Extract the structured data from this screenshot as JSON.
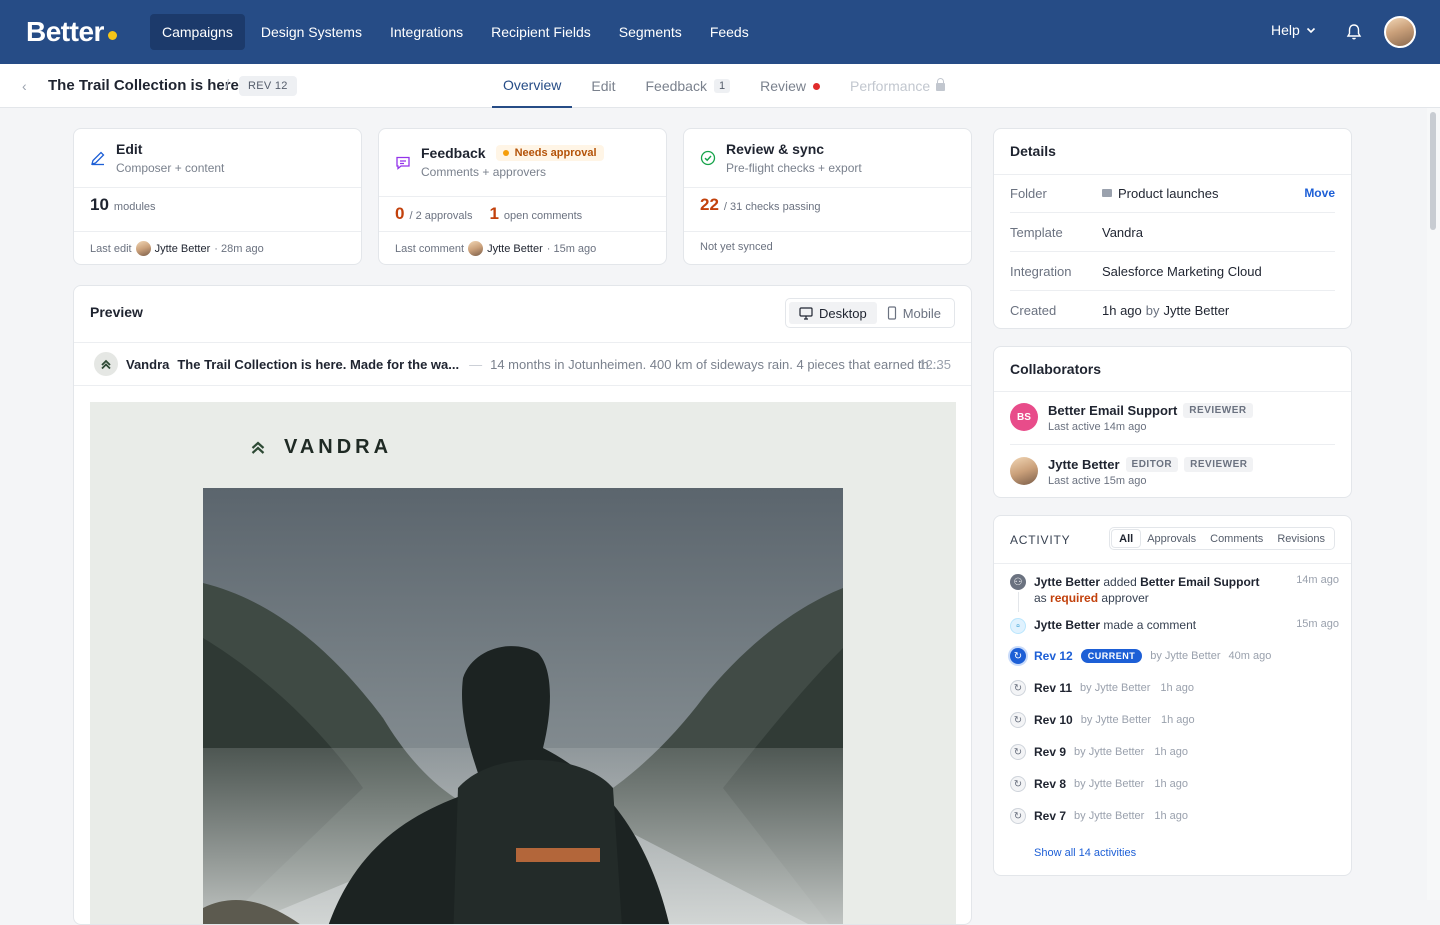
{
  "brand": {
    "name": "Better"
  },
  "nav": {
    "items": [
      "Campaigns",
      "Design Systems",
      "Integrations",
      "Recipient Fields",
      "Segments",
      "Feeds"
    ],
    "help": "Help"
  },
  "subbar": {
    "title": "The Trail Collection is here",
    "rev": "REV 12",
    "tabs": {
      "overview": "Overview",
      "edit": "Edit",
      "feedback": "Feedback",
      "feedback_count": "1",
      "review": "Review",
      "performance": "Performance"
    }
  },
  "cards": {
    "edit": {
      "title": "Edit",
      "sub": "Composer + content",
      "num": "10",
      "num_label": "modules",
      "foot_label": "Last edit",
      "foot_user": "Jytte Better",
      "foot_time": "· 28m ago"
    },
    "feedback": {
      "title": "Feedback",
      "badge": "Needs approval",
      "sub": "Comments + approvers",
      "num1": "0",
      "num1_label": "/ 2 approvals",
      "num2": "1",
      "num2_label": "open comments",
      "foot_label": "Last comment",
      "foot_user": "Jytte Better",
      "foot_time": "· 15m ago"
    },
    "review": {
      "title": "Review & sync",
      "sub": "Pre-flight checks + export",
      "num": "22",
      "num_label": "/ 31 checks passing",
      "foot": "Not yet synced"
    }
  },
  "preview": {
    "title": "Preview",
    "desktop": "Desktop",
    "mobile": "Mobile",
    "sender": "Vandra",
    "subject": "The Trail Collection is here. Made for the wa...",
    "preheader": "14 months in Jotunheimen. 400 km of sideways rain. 4 pieces that earned th...",
    "time": "12:35",
    "email_brand": "VANDRA"
  },
  "details": {
    "title": "Details",
    "folder_label": "Folder",
    "folder_value": "Product launches",
    "move": "Move",
    "template_label": "Template",
    "template_value": "Vandra",
    "integration_label": "Integration",
    "integration_value": "Salesforce Marketing Cloud",
    "created_label": "Created",
    "created_value": "1h ago",
    "created_by": "by",
    "created_user": "Jytte Better"
  },
  "collaborators": {
    "title": "Collaborators",
    "list": [
      {
        "initials": "BS",
        "name": "Better Email Support",
        "roles": [
          "REVIEWER"
        ],
        "last": "Last active 14m ago"
      },
      {
        "initials": "",
        "name": "Jytte Better",
        "roles": [
          "EDITOR",
          "REVIEWER"
        ],
        "last": "Last active 15m ago"
      }
    ]
  },
  "activity": {
    "title": "ACTIVITY",
    "filters": [
      "All",
      "Approvals",
      "Comments",
      "Revisions"
    ],
    "e1": {
      "user": "Jytte Better",
      "t1": "added",
      "target": "Better Email Support",
      "t2": "as",
      "req": "required",
      "t3": "approver",
      "time": "14m ago"
    },
    "e2": {
      "user": "Jytte Better",
      "t1": "made a comment",
      "time": "15m ago"
    },
    "revs": [
      {
        "rev": "Rev 12",
        "badge": "CURRENT",
        "by": "by Jytte Better",
        "time": "40m ago"
      },
      {
        "rev": "Rev 11",
        "by": "by Jytte Better",
        "time": "1h ago"
      },
      {
        "rev": "Rev 10",
        "by": "by Jytte Better",
        "time": "1h ago"
      },
      {
        "rev": "Rev 9",
        "by": "by Jytte Better",
        "time": "1h ago"
      },
      {
        "rev": "Rev 8",
        "by": "by Jytte Better",
        "time": "1h ago"
      },
      {
        "rev": "Rev 7",
        "by": "by Jytte Better",
        "time": "1h ago"
      }
    ],
    "show_all": "Show all 14 activities"
  },
  "colors": {
    "nav_bg": "#264c86",
    "accent_blue": "#1d5fd6",
    "brand_dot": "#f5c518",
    "warning": "#c2410c",
    "pink_avatar": "#e84c8a"
  }
}
